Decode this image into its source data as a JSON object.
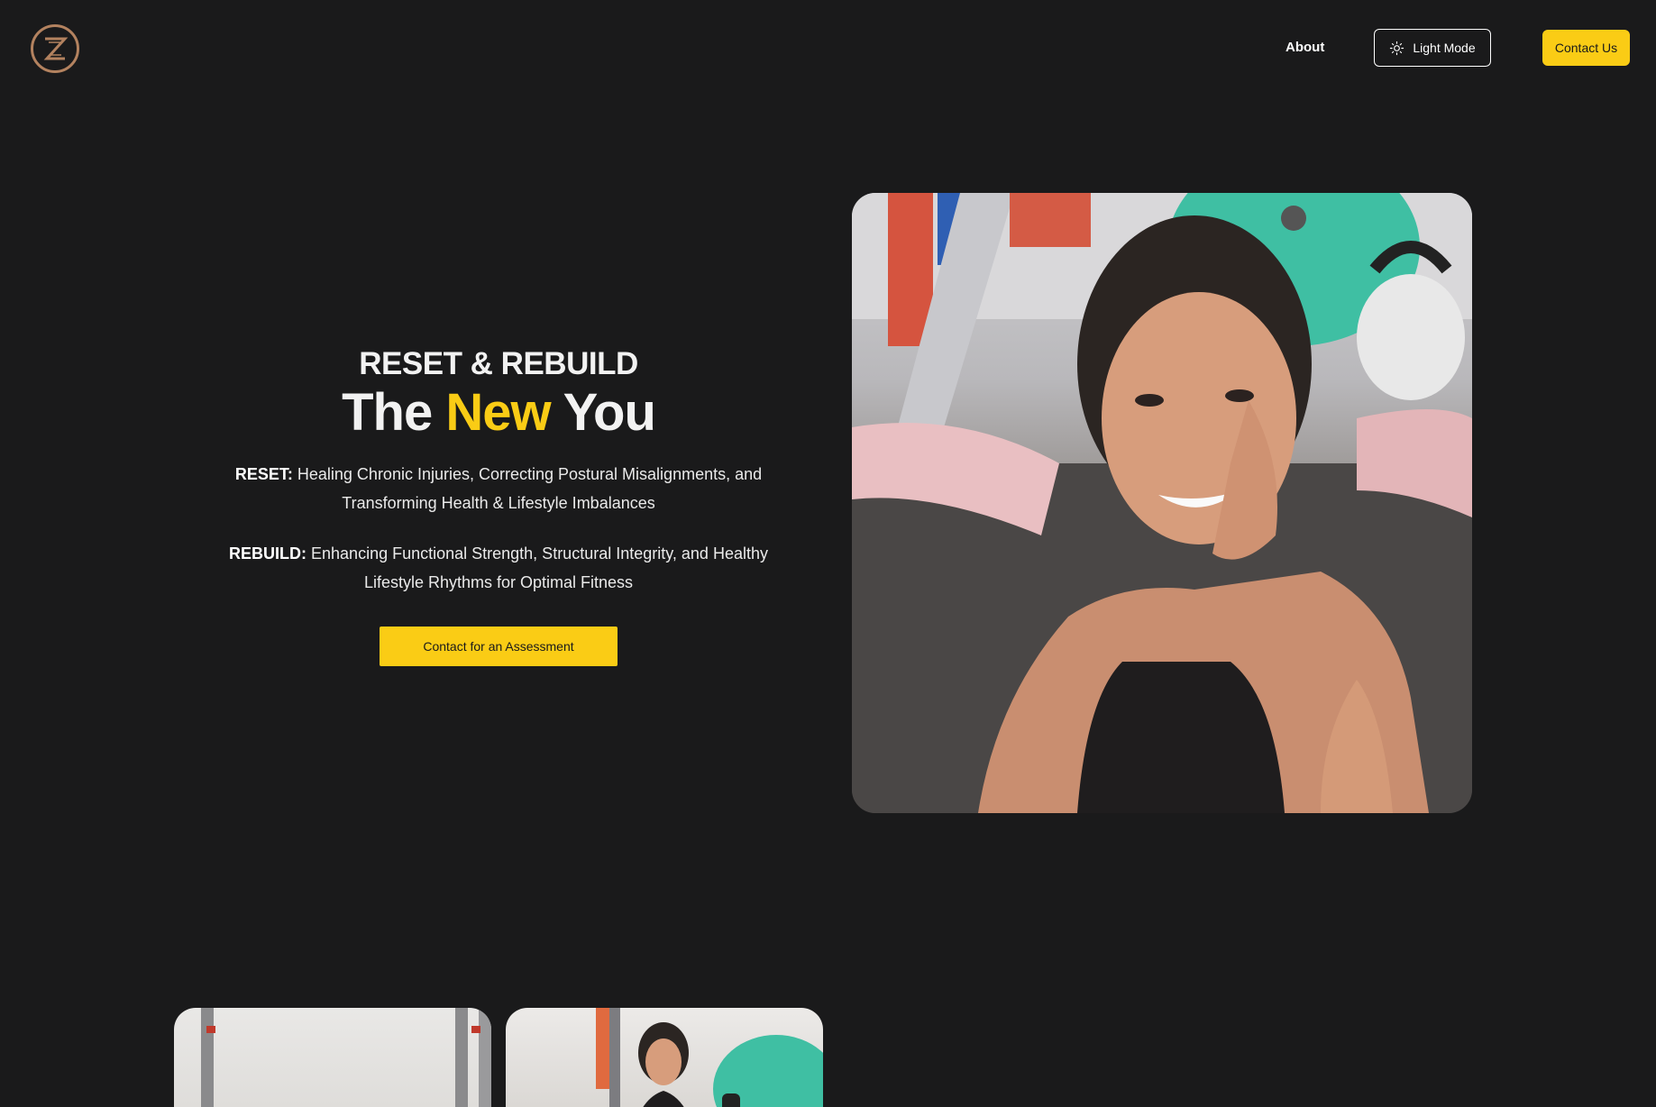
{
  "header": {
    "logo_icon": "z-monogram-logo",
    "nav_about": "About",
    "theme_toggle_label": "Light Mode",
    "theme_toggle_icon": "sun-icon",
    "contact_label": "Contact Us"
  },
  "hero": {
    "eyebrow": "RESET & REBUILD",
    "headline_part1": "The ",
    "headline_accent": "New",
    "headline_part2": " You",
    "reset_label": "RESET:",
    "reset_text": " Healing Chronic Injuries, Correcting Postural Misalignments, and Transforming Health & Lifestyle Imbalances",
    "rebuild_label": "REBUILD:",
    "rebuild_text": " Enhancing Functional Strength, Structural Integrity, and Healthy Lifestyle Rhythms for Optimal Fitness",
    "cta_label": "Contact for an Assessment"
  },
  "colors": {
    "background": "#1a1a1b",
    "accent": "#facc15",
    "logo_ring": "#b3825f"
  }
}
